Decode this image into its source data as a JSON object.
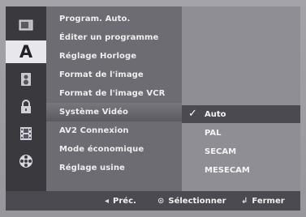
{
  "sidebar": {
    "icons": [
      {
        "name": "disc-tray-icon"
      },
      {
        "name": "language-icon",
        "glyph": "A"
      },
      {
        "name": "speaker-icon"
      },
      {
        "name": "lock-icon"
      },
      {
        "name": "film-icon"
      },
      {
        "name": "reel-icon"
      }
    ]
  },
  "menu": {
    "items": [
      {
        "label": "Program. Auto."
      },
      {
        "label": "Éditer un programme"
      },
      {
        "label": "Réglage Horloge"
      },
      {
        "label": "Format de l'image"
      },
      {
        "label": "Format de l'image VCR"
      },
      {
        "label": "Système Vidéo"
      },
      {
        "label": "AV2 Connexion"
      },
      {
        "label": "Mode économique"
      },
      {
        "label": "Réglage usine"
      }
    ],
    "selected_index": 5
  },
  "options": {
    "check_glyph": "✓",
    "items": [
      {
        "label": "Auto"
      },
      {
        "label": "PAL"
      },
      {
        "label": "SECAM"
      },
      {
        "label": "MESECAM"
      }
    ],
    "selected_index": 0
  },
  "footer": {
    "prev": {
      "glyph": "◂",
      "label": "Préc."
    },
    "select": {
      "glyph": "⊙",
      "label": "Sélectionner"
    },
    "close": {
      "glyph": "↲",
      "label": "Fermer"
    }
  }
}
